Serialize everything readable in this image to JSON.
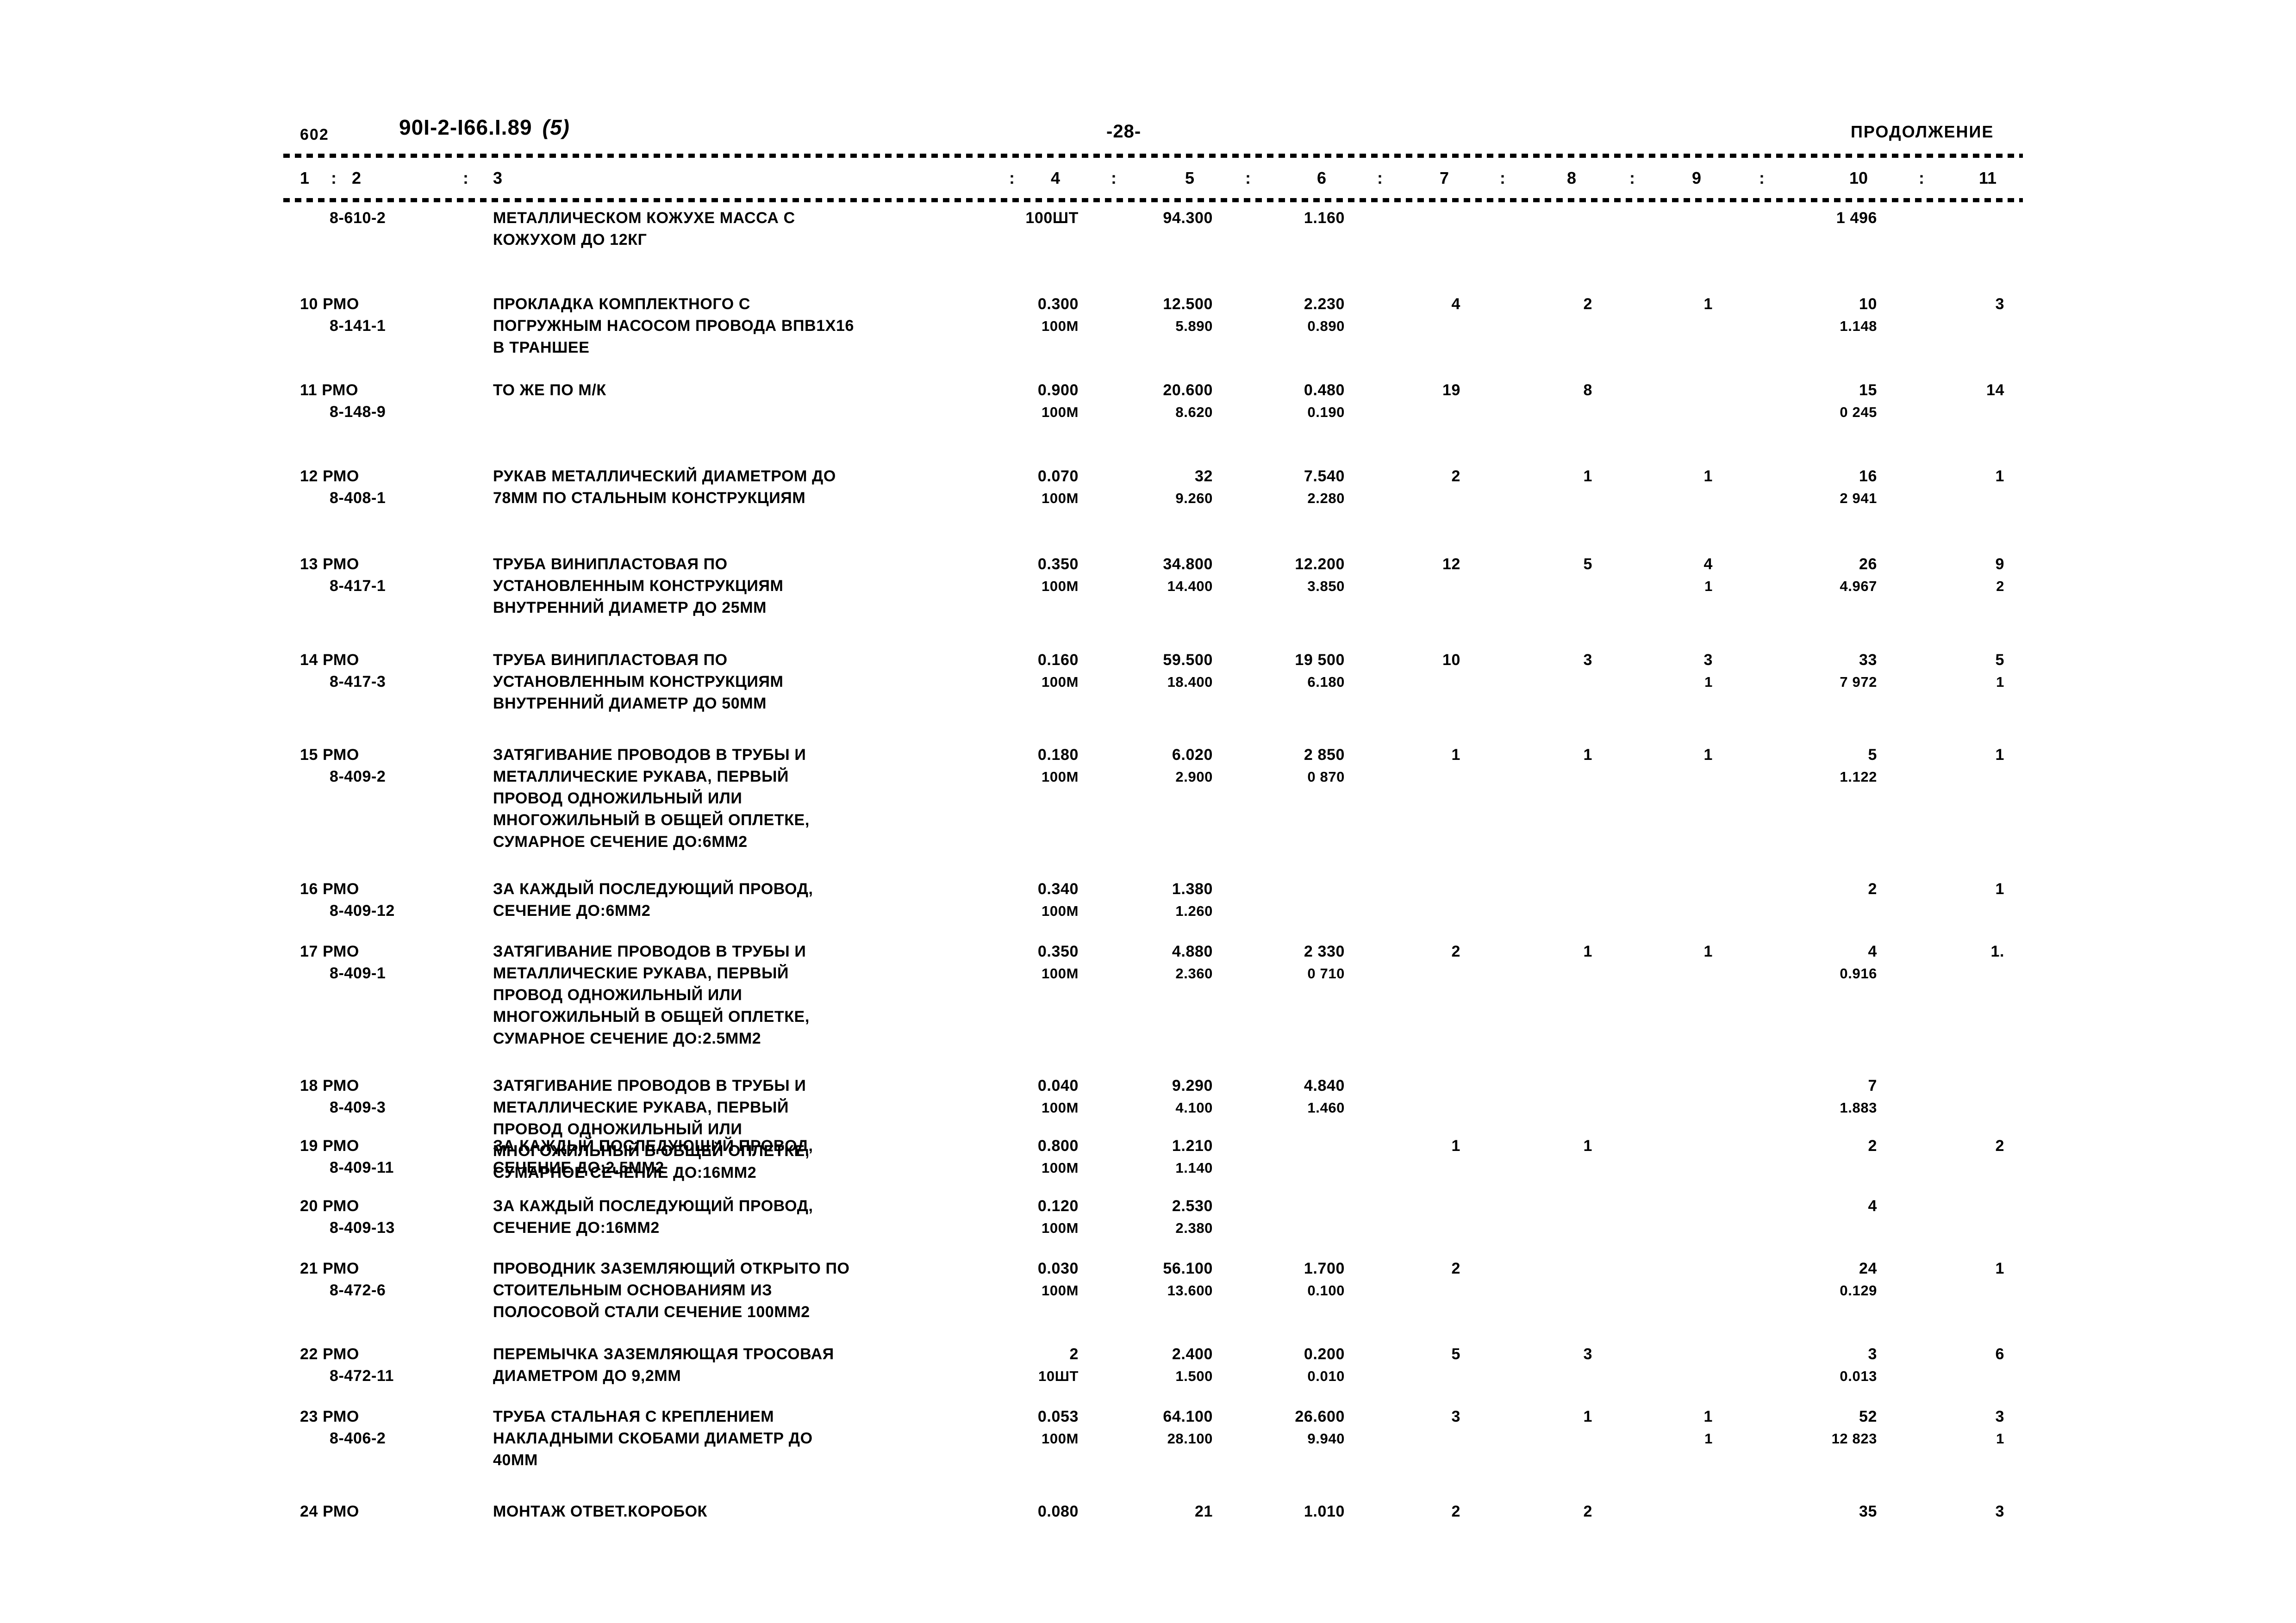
{
  "header": {
    "folio": "602",
    "doc_code": "90I-2-I66.I.89",
    "doc_code_suffix": "(5)",
    "page_marker": "-28-",
    "continuation": "ПРОДОЛЖЕНИЕ"
  },
  "column_headers": [
    "1",
    "2",
    "3",
    "4",
    "5",
    "6",
    "7",
    "8",
    "9",
    "10",
    "11"
  ],
  "column_separator": ":",
  "rows": [
    {
      "num": "",
      "code": "8-610-2",
      "desc": [
        "МЕТАЛЛИЧЕСКОМ КОЖУХЕ МАССА С",
        "КОЖУХОМ ДО 12КГ"
      ],
      "c4": [
        "100ШТ"
      ],
      "c5": [
        "94.300"
      ],
      "c6": [
        "1.160"
      ],
      "c7": [
        ""
      ],
      "c8": [
        ""
      ],
      "c9": [
        ""
      ],
      "c10": [
        "1 496"
      ],
      "c11": [
        ""
      ]
    },
    {
      "num": "10 РМО",
      "code": "8-141-1",
      "desc": [
        "ПРОКЛАДКА КОМПЛЕКТНОГО С",
        "ПОГРУЖНЫМ НАСОСОМ ПРОВОДА ВПВ1Х16",
        "В ТРАНШЕЕ"
      ],
      "c4": [
        "0.300",
        "100М"
      ],
      "c5": [
        "12.500",
        "5.890"
      ],
      "c6": [
        "2.230",
        "0.890"
      ],
      "c7": [
        "4"
      ],
      "c8": [
        "2"
      ],
      "c9": [
        "1"
      ],
      "c10": [
        "10",
        "1.148"
      ],
      "c11": [
        "3"
      ]
    },
    {
      "num": "11 РМО",
      "code": "8-148-9",
      "desc": [
        "ТО ЖЕ ПО М/К"
      ],
      "c4": [
        "0.900",
        "100М"
      ],
      "c5": [
        "20.600",
        "8.620"
      ],
      "c6": [
        "0.480",
        "0.190"
      ],
      "c7": [
        "19"
      ],
      "c8": [
        "8"
      ],
      "c9": [
        ""
      ],
      "c10": [
        "15",
        "0 245"
      ],
      "c11": [
        "14"
      ]
    },
    {
      "num": "12 РМО",
      "code": "8-408-1",
      "desc": [
        "РУКАВ МЕТАЛЛИЧЕСКИЙ ДИАМЕТРОМ ДО",
        "78ММ ПО СТАЛЬНЫМ КОНСТРУКЦИЯМ"
      ],
      "c4": [
        "0.070",
        "100М"
      ],
      "c5": [
        "32",
        "9.260"
      ],
      "c6": [
        "7.540",
        "2.280"
      ],
      "c7": [
        "2"
      ],
      "c8": [
        "1"
      ],
      "c9": [
        "1"
      ],
      "c10": [
        "16",
        "2 941"
      ],
      "c11": [
        "1"
      ]
    },
    {
      "num": "13 РМО",
      "code": "8-417-1",
      "desc": [
        "ТРУБА ВИНИПЛАСТОВАЯ ПО",
        "УСТАНОВЛЕННЫМ КОНСТРУКЦИЯМ",
        "ВНУТРЕННИЙ ДИАМЕТР ДО 25ММ"
      ],
      "c4": [
        "0.350",
        "100М"
      ],
      "c5": [
        "34.800",
        "14.400"
      ],
      "c6": [
        "12.200",
        "3.850"
      ],
      "c7": [
        "12"
      ],
      "c8": [
        "5"
      ],
      "c9": [
        "4",
        "1"
      ],
      "c10": [
        "26",
        "4.967"
      ],
      "c11": [
        "9",
        "2"
      ]
    },
    {
      "num": "14 РМО",
      "code": "8-417-3",
      "desc": [
        "ТРУБА ВИНИПЛАСТОВАЯ ПО",
        "УСТАНОВЛЕННЫМ КОНСТРУКЦИЯМ",
        "ВНУТРЕННИЙ ДИАМЕТР ДО 50ММ"
      ],
      "c4": [
        "0.160",
        "100М"
      ],
      "c5": [
        "59.500",
        "18.400"
      ],
      "c6": [
        "19 500",
        "6.180"
      ],
      "c7": [
        "10"
      ],
      "c8": [
        "3"
      ],
      "c9": [
        "3",
        "1"
      ],
      "c10": [
        "33",
        "7 972"
      ],
      "c11": [
        "5",
        "1"
      ]
    },
    {
      "num": "15 РМО",
      "code": "8-409-2",
      "desc": [
        "ЗАТЯГИВАНИЕ ПРОВОДОВ В ТРУБЫ И",
        "МЕТАЛЛИЧЕСКИЕ РУКАВА, ПЕРВЫЙ",
        "ПРОВОД ОДНОЖИЛЬНЫЙ ИЛИ",
        "МНОГОЖИЛЬНЫЙ В ОБЩЕЙ ОПЛЕТКЕ,",
        "СУМАРНОЕ СЕЧЕНИЕ ДО:6ММ2"
      ],
      "c4": [
        "0.180",
        "100М"
      ],
      "c5": [
        "6.020",
        "2.900"
      ],
      "c6": [
        "2 850",
        "0 870"
      ],
      "c7": [
        "1"
      ],
      "c8": [
        "1"
      ],
      "c9": [
        "1"
      ],
      "c10": [
        "5",
        "1.122"
      ],
      "c11": [
        "1"
      ]
    },
    {
      "num": "16 РМО",
      "code": "8-409-12",
      "desc": [
        "ЗА КАЖДЫЙ ПОСЛЕДУЮЩИЙ ПРОВОД,",
        "СЕЧЕНИЕ ДО:6ММ2"
      ],
      "c4": [
        "0.340",
        "100М"
      ],
      "c5": [
        "1.380",
        "1.260"
      ],
      "c6": [
        ""
      ],
      "c7": [
        ""
      ],
      "c8": [
        ""
      ],
      "c9": [
        ""
      ],
      "c10": [
        "2"
      ],
      "c11": [
        "1"
      ]
    },
    {
      "num": "17 РМО",
      "code": "8-409-1",
      "desc": [
        "ЗАТЯГИВАНИЕ ПРОВОДОВ В ТРУБЫ И",
        "МЕТАЛЛИЧЕСКИЕ РУКАВА, ПЕРВЫЙ",
        "ПРОВОД ОДНОЖИЛЬНЫЙ ИЛИ",
        "МНОГОЖИЛЬНЫЙ В ОБЩЕЙ ОПЛЕТКЕ,",
        "СУМАРНОЕ СЕЧЕНИЕ ДО:2.5ММ2"
      ],
      "c4": [
        "0.350",
        "100М"
      ],
      "c5": [
        "4.880",
        "2.360"
      ],
      "c6": [
        "2 330",
        "0 710"
      ],
      "c7": [
        "2"
      ],
      "c8": [
        "1"
      ],
      "c9": [
        "1"
      ],
      "c10": [
        "4",
        "0.916"
      ],
      "c11": [
        "1."
      ]
    },
    {
      "num": "18 РМО",
      "code": "8-409-3",
      "desc": [
        "ЗАТЯГИВАНИЕ ПРОВОДОВ В ТРУБЫ И",
        "МЕТАЛЛИЧЕСКИЕ РУКАВА, ПЕРВЫЙ",
        "ПРОВОД ОДНОЖИЛЬНЫЙ ИЛИ",
        "МНОГОЖИЛЬНЫЙ В ОБЩЕЙ ОПЛЕТКЕ,",
        "СУМАРНОЕ СЕЧЕНИЕ ДО:16ММ2"
      ],
      "c4": [
        "0.040",
        "100М"
      ],
      "c5": [
        "9.290",
        "4.100"
      ],
      "c6": [
        "4.840",
        "1.460"
      ],
      "c7": [
        ""
      ],
      "c8": [
        ""
      ],
      "c9": [
        ""
      ],
      "c10": [
        "7",
        "1.883"
      ],
      "c11": [
        ""
      ]
    },
    {
      "num": "19 РМО",
      "code": "8-409-11",
      "desc": [
        "ЗА КАЖДЫЙ ПОСЛЕДУЮЩИЙ ПРОВОД,",
        "СЕЧЕНИЕ ДО:2.5ММ2"
      ],
      "c4": [
        "0.800",
        "100М"
      ],
      "c5": [
        "1.210",
        "1.140"
      ],
      "c6": [
        ""
      ],
      "c7": [
        "1"
      ],
      "c8": [
        "1"
      ],
      "c9": [
        ""
      ],
      "c10": [
        "2"
      ],
      "c11": [
        "2"
      ]
    },
    {
      "num": "20 РМО",
      "code": "8-409-13",
      "desc": [
        "ЗА КАЖДЫЙ ПОСЛЕДУЮЩИЙ ПРОВОД,",
        "СЕЧЕНИЕ ДО:16ММ2"
      ],
      "c4": [
        "0.120",
        "100М"
      ],
      "c5": [
        "2.530",
        "2.380"
      ],
      "c6": [
        ""
      ],
      "c7": [
        ""
      ],
      "c8": [
        ""
      ],
      "c9": [
        ""
      ],
      "c10": [
        "4"
      ],
      "c11": [
        ""
      ]
    },
    {
      "num": "21 РМО",
      "code": "8-472-6",
      "desc": [
        "ПРОВОДНИК ЗАЗЕМЛЯЮЩИЙ ОТКРЫТО ПО",
        "СТОИТЕЛЬНЫМ ОСНОВАНИЯМ ИЗ",
        "ПОЛОСОВОЙ СТАЛИ СЕЧЕНИЕ 100ММ2"
      ],
      "c4": [
        "0.030",
        "100М"
      ],
      "c5": [
        "56.100",
        "13.600"
      ],
      "c6": [
        "1.700",
        "0.100"
      ],
      "c7": [
        "2"
      ],
      "c8": [
        ""
      ],
      "c9": [
        ""
      ],
      "c10": [
        "24",
        "0.129"
      ],
      "c11": [
        "1"
      ]
    },
    {
      "num": "22 РМО",
      "code": "8-472-11",
      "desc": [
        "ПЕРЕМЫЧКА ЗАЗЕМЛЯЮЩАЯ ТРОСОВАЯ",
        "ДИАМЕТРОМ ДО 9,2ММ"
      ],
      "c4": [
        "2",
        "10ШТ"
      ],
      "c5": [
        "2.400",
        "1.500"
      ],
      "c6": [
        "0.200",
        "0.010"
      ],
      "c7": [
        "5"
      ],
      "c8": [
        "3"
      ],
      "c9": [
        ""
      ],
      "c10": [
        "3",
        "0.013"
      ],
      "c11": [
        "6"
      ]
    },
    {
      "num": "23 РМО",
      "code": "8-406-2",
      "desc": [
        "ТРУБА СТАЛЬНАЯ С КРЕПЛЕНИЕМ",
        "НАКЛАДНЫМИ СКОБАМИ ДИАМЕТР ДО",
        "40ММ"
      ],
      "c4": [
        "0.053",
        "100М"
      ],
      "c5": [
        "64.100",
        "28.100"
      ],
      "c6": [
        "26.600",
        "9.940"
      ],
      "c7": [
        "3"
      ],
      "c8": [
        "1"
      ],
      "c9": [
        "1",
        "1"
      ],
      "c10": [
        "52",
        "12 823"
      ],
      "c11": [
        "3",
        "1"
      ]
    },
    {
      "num": "24 РМО",
      "code": "",
      "desc": [
        "МОНТАЖ ОТВЕТ.КОРОБОК"
      ],
      "c4": [
        "0.080"
      ],
      "c5": [
        "21"
      ],
      "c6": [
        "1.010"
      ],
      "c7": [
        "2"
      ],
      "c8": [
        "2"
      ],
      "c9": [
        ""
      ],
      "c10": [
        "35"
      ],
      "c11": [
        "3"
      ]
    }
  ]
}
